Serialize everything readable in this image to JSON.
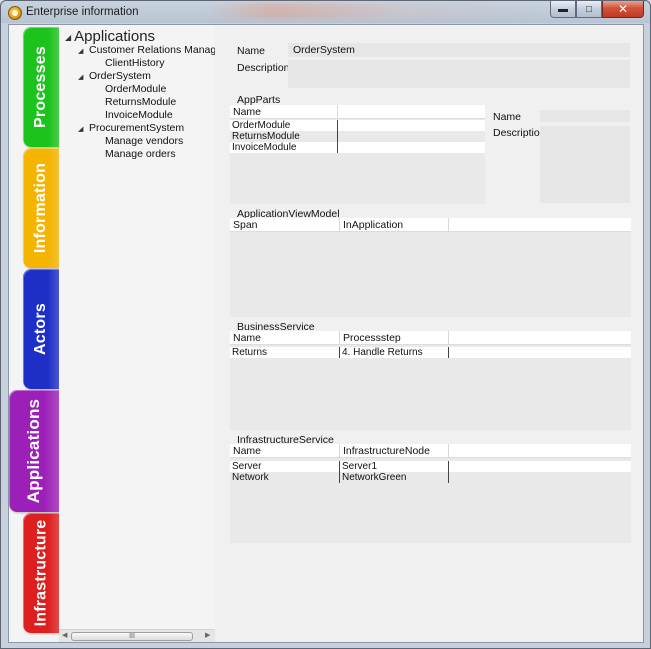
{
  "window": {
    "title": "Enterprise information"
  },
  "tabs": [
    {
      "label": "Processes",
      "color": "#1dc31d"
    },
    {
      "label": "Information",
      "color": "#f4b400"
    },
    {
      "label": "Actors",
      "color": "#1e2fc8"
    },
    {
      "label": "Applications",
      "color": "#9c1fb8",
      "active": true
    },
    {
      "label": "Infrastructure",
      "color": "#dd1f1f"
    }
  ],
  "tree": {
    "root": "Applications",
    "nodes": [
      {
        "label": "Customer Relations Manageme",
        "level": 1,
        "expanded": true
      },
      {
        "label": "ClientHistory",
        "level": 2
      },
      {
        "label": "OrderSystem",
        "level": 1,
        "expanded": true
      },
      {
        "label": "OrderModule",
        "level": 2
      },
      {
        "label": "ReturnsModule",
        "level": 2
      },
      {
        "label": "InvoiceModule",
        "level": 2
      },
      {
        "label": "ProcurementSystem",
        "level": 1,
        "expanded": true
      },
      {
        "label": "Manage vendors",
        "level": 2
      },
      {
        "label": "Manage orders",
        "level": 2
      }
    ],
    "scroll_thumb_glyph": "III"
  },
  "details": {
    "name_label": "Name",
    "name_value": "OrderSystem",
    "description_label": "Description",
    "description_value": ""
  },
  "app_parts": {
    "title": "AppParts",
    "columns": [
      "Name",
      ""
    ],
    "rows": [
      [
        "OrderModule",
        ""
      ],
      [
        "ReturnsModule",
        ""
      ],
      [
        "InvoiceModule",
        ""
      ]
    ],
    "side_name_label": "Name",
    "side_description_label": "Description"
  },
  "view_model": {
    "title": "ApplicationViewModel",
    "columns": [
      "Span",
      "InApplication",
      ""
    ],
    "rows": []
  },
  "business_service": {
    "title": "BusinessService",
    "columns": [
      "Name",
      "Processstep",
      ""
    ],
    "rows": [
      [
        "Returns",
        "4. Handle Returns",
        ""
      ]
    ]
  },
  "infrastructure_service": {
    "title": "InfrastructureService",
    "columns": [
      "Name",
      "InfrastructureNode",
      ""
    ],
    "rows": [
      [
        "Server",
        "Server1",
        ""
      ],
      [
        "Network",
        "NetworkGreen",
        ""
      ]
    ]
  }
}
